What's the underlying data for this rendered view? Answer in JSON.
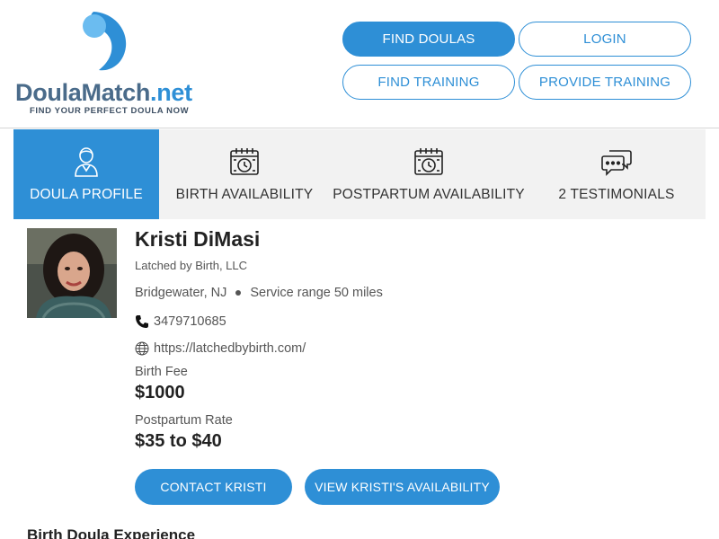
{
  "brand": {
    "name_part1": "DoulaMatch",
    "name_part2": ".net",
    "tagline": "FIND YOUR PERFECT DOULA NOW",
    "colors": {
      "primary": "#2e8fd6",
      "light": "#6bbcf0",
      "navy": "#4a6b8a"
    }
  },
  "nav": {
    "find_doulas": "FIND DOULAS",
    "login": "LOGIN",
    "find_training": "FIND TRAINING",
    "provide_training": "PROVIDE TRAINING"
  },
  "tabs": [
    {
      "label": "DOULA PROFILE",
      "icon": "doula-person-icon",
      "active": true
    },
    {
      "label": "BIRTH AVAILABILITY",
      "icon": "calendar-clock-icon",
      "active": false
    },
    {
      "label": "POSTPARTUM AVAILABILITY",
      "icon": "calendar-clock-icon",
      "active": false
    },
    {
      "label": "2 TESTIMONIALS",
      "icon": "chat-bubbles-icon",
      "active": false
    }
  ],
  "profile": {
    "name": "Kristi DiMasi",
    "company": "Latched by Birth, LLC",
    "location": "Bridgewater, NJ",
    "service_range": "Service range 50 miles",
    "phone": "3479710685",
    "website": "https://latchedbybirth.com/",
    "birth_fee_label": "Birth Fee",
    "birth_fee": "$1000",
    "postpartum_label": "Postpartum Rate",
    "postpartum_rate": "$35 to $40",
    "contact_button": "CONTACT KRISTI",
    "availability_button": "VIEW KRISTI'S AVAILABILITY"
  },
  "sections": {
    "experience_heading": "Birth Doula Experience"
  }
}
